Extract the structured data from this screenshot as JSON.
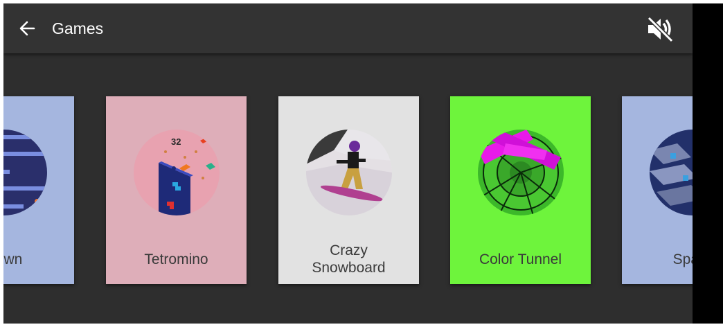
{
  "header": {
    "title": "Games",
    "back_icon": "arrow-back-icon",
    "mute_icon": "volume-off-icon"
  },
  "games": [
    {
      "label": "Down",
      "color": "#a5b6df"
    },
    {
      "label": "Tetromino",
      "color": "#deaeb9",
      "score": "32"
    },
    {
      "label_line1": "Crazy",
      "label_line2": "Snowboard",
      "color": "#e2e2e2"
    },
    {
      "label": "Color Tunnel",
      "color": "#6ef43c"
    },
    {
      "label": "Spac",
      "color": "#a5b6df"
    }
  ]
}
